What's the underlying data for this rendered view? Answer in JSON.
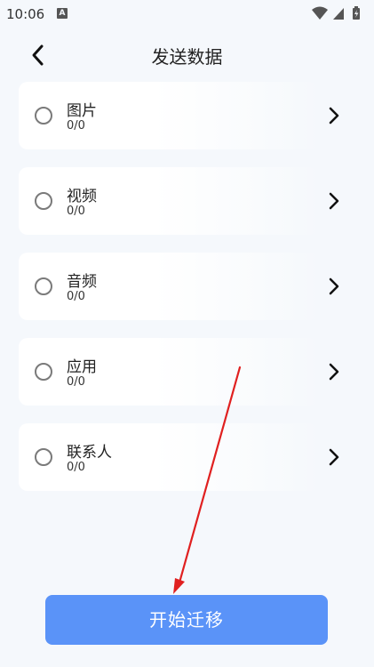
{
  "status_bar": {
    "time": "10:06",
    "notification_icon": "A"
  },
  "header": {
    "title": "发送数据",
    "back_icon": "chevron-left-icon"
  },
  "categories": [
    {
      "name": "图片",
      "count": "0/0"
    },
    {
      "name": "视频",
      "count": "0/0"
    },
    {
      "name": "音频",
      "count": "0/0"
    },
    {
      "name": "应用",
      "count": "0/0"
    },
    {
      "name": "联系人",
      "count": "0/0"
    }
  ],
  "actions": {
    "start_label": "开始迁移"
  },
  "colors": {
    "button": "#5a93f8",
    "annotation_arrow": "#e02020",
    "background": "#f5f8fc"
  }
}
